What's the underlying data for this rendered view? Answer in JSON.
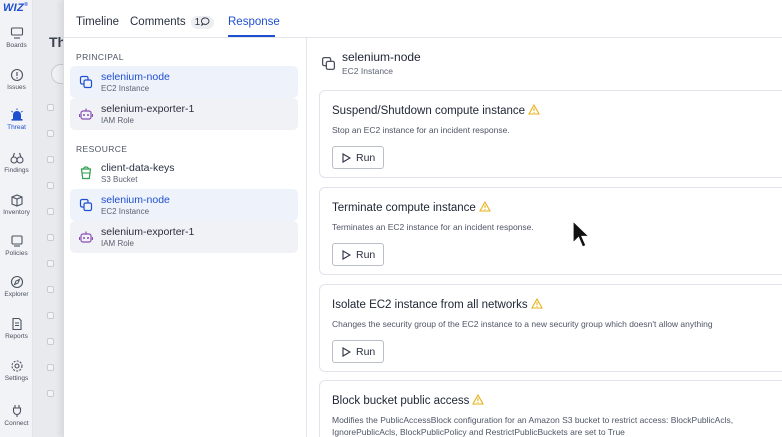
{
  "nav": {
    "logo": "WIZ",
    "logo_sup": "®",
    "items": [
      {
        "label": "Boards",
        "icon": "boards-icon"
      },
      {
        "label": "Issues",
        "icon": "issues-icon"
      },
      {
        "label": "Threat",
        "icon": "threat-icon",
        "active": true
      },
      {
        "label": "Findings",
        "icon": "findings-icon"
      },
      {
        "label": "Inventory",
        "icon": "inventory-icon"
      },
      {
        "label": "Policies",
        "icon": "policies-icon"
      },
      {
        "label": "Explorer",
        "icon": "explorer-icon"
      },
      {
        "label": "Reports",
        "icon": "reports-icon"
      },
      {
        "label": "Settings",
        "icon": "settings-icon"
      },
      {
        "label": "Connect",
        "icon": "connect-icon"
      }
    ]
  },
  "background": {
    "title": "Th"
  },
  "tabs": {
    "timeline": "Timeline",
    "comments": "Comments",
    "comments_count": "1",
    "response": "Response"
  },
  "principal": {
    "heading": "PRINCIPAL",
    "items": [
      {
        "name": "selenium-node",
        "type": "EC2 Instance"
      },
      {
        "name": "selenium-exporter-1",
        "type": "IAM Role"
      }
    ]
  },
  "resource": {
    "heading": "RESOURCE",
    "items": [
      {
        "name": "client-data-keys",
        "type": "S3 Bucket"
      },
      {
        "name": "selenium-node",
        "type": "EC2 Instance"
      },
      {
        "name": "selenium-exporter-1",
        "type": "IAM Role"
      }
    ]
  },
  "detail": {
    "name": "selenium-node",
    "type": "EC2 Instance",
    "run_label": "Run",
    "actions": [
      {
        "title": "Suspend/Shutdown compute instance",
        "description": "Stop an EC2 instance for an incident response."
      },
      {
        "title": "Terminate compute instance",
        "description": "Terminates an EC2 instance for an incident response."
      },
      {
        "title": "Isolate EC2 instance from all networks",
        "description": "Changes the security group of the EC2 instance to a new security group which doesn't allow anything"
      },
      {
        "title": "Block bucket public access",
        "description": "Modifies the PublicAccessBlock configuration for an Amazon S3 bucket to restrict access: BlockPublicAcls, IgnorePublicAcls, BlockPublicPolicy and RestrictPublicBuckets are set to True"
      }
    ]
  },
  "colors": {
    "accent": "#1f4fd1",
    "warning": "#e8b21a",
    "robot": "#8a4fb8",
    "bucket": "#2f9e4f"
  }
}
